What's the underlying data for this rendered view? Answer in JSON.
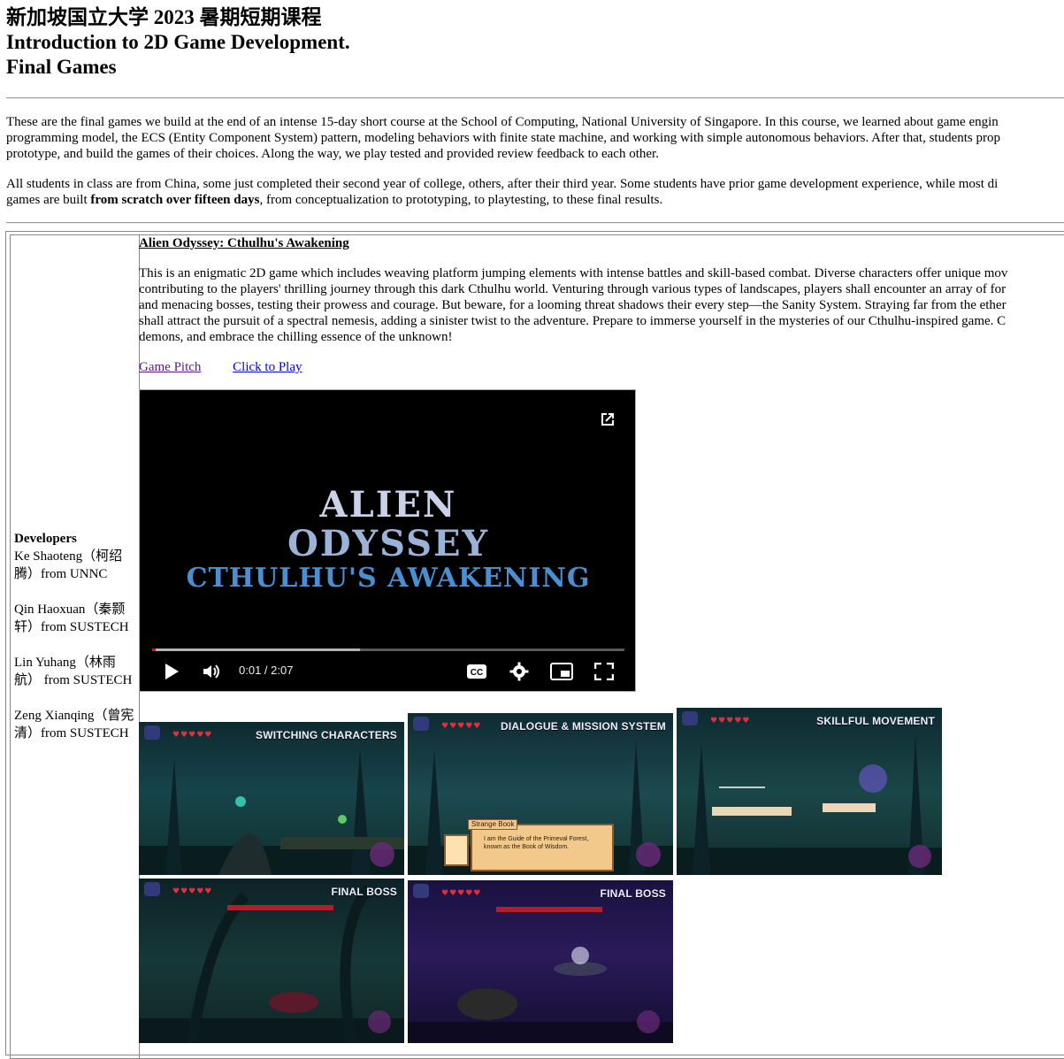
{
  "header": {
    "line1": "新加坡国立大学 2023 暑期短期课程",
    "line2": "Introduction to 2D Game Development.",
    "line3": "Final Games"
  },
  "intro": {
    "p1_line1": "These are the final games we build at the end of an intense 15-day short course at the School of Computing, National University of Singapore. In this course, we learned about game engin",
    "p1_line2": "programming model, the ECS (Entity Component System) pattern, modeling behaviors with finite state machine, and working with simple autonomous behaviors. After that, students prop",
    "p1_line3": "prototype, and build the games of their choices. Along the way, we play tested and provided review feedback to each other.",
    "p2_line1": "All students in class are from China, some just completed their second year of college, others, after their third year. Some students have prior game development experience, while most di",
    "p2_line2_pre": "games are built ",
    "p2_line2_bold": "from scratch over fifteen days",
    "p2_line2_post": ", from conceptualization to prototyping, to playtesting, to these final results."
  },
  "developers": {
    "title": "Developers",
    "items": [
      "Ke Shaoteng（柯绍腾）from UNNC",
      "Qin Haoxuan（秦颢轩）from SUSTECH",
      "Lin Yuhang（林雨航） from SUSTECH",
      "Zeng Xianqing（曾宪清）from SUSTECH"
    ]
  },
  "game": {
    "title": "Alien Odyssey: Cthulhu's Awakening",
    "desc_lines": [
      "This is an enigmatic 2D game which includes weaving platform jumping elements with intense battles and skill-based combat. Diverse characters offer unique mov",
      "contributing to the players' thrilling journey through this dark Cthulhu world. Venturing through various types of landscapes, players shall encounter an array of for",
      "and menacing bosses, testing their prowess and courage. But beware, for a looming threat shadows their every step—the Sanity System. Straying far from the ether",
      "shall attract the pursuit of a spectral nemesis, adding a sinister twist to the adventure. Prepare to immerse yourself in the mysteries of our Cthulhu-inspired game. C",
      "demons, and embrace the chilling essence of the unknown!"
    ],
    "link_pitch": "Game Pitch",
    "link_play": "Click to Play"
  },
  "video": {
    "title_line1": "ALIEN",
    "title_line2": "ODYSSEY",
    "title_line3": "CTHULHU'S AWAKENING",
    "time": "0:01 / 2:07",
    "progress": 0.004,
    "buffered": 0.44,
    "colors": {
      "accent": "#ff0000"
    }
  },
  "screenshots": [
    {
      "caption": "SWITCHING CHARACTERS"
    },
    {
      "caption": "DIALOGUE & MISSION SYSTEM",
      "dialog_title": "Strange Book",
      "dialog_text1": "I am the Guide of the Primeval Forest,",
      "dialog_text2": "known as the Book of Wisdom."
    },
    {
      "caption": "SKILLFUL MOVEMENT"
    },
    {
      "caption": "FINAL BOSS"
    },
    {
      "caption": "FINAL BOSS"
    }
  ]
}
